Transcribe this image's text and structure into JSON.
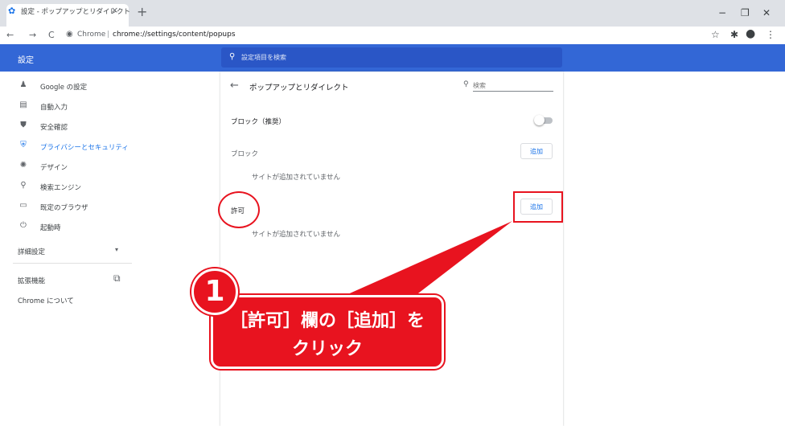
{
  "browser": {
    "tab": {
      "title": "設定 - ポップアップとリダイレクト",
      "favicon": "gear-icon",
      "close": "×"
    },
    "new_tab": "+",
    "window_controls": {
      "minimize": "−",
      "restore": "❐",
      "close": "✕"
    },
    "toolbar": {
      "back": "←",
      "forward": "→",
      "reload": "C",
      "url_host": "Chrome",
      "url_separator": "|",
      "url_path": "chrome://settings/content/popups",
      "star": "☆",
      "extensions": "✱",
      "profile": "●",
      "menu": "⋮"
    }
  },
  "settings": {
    "app_title": "設定",
    "search_placeholder": "設定項目を検索",
    "sidebar": {
      "items": [
        {
          "label": "Google の設定",
          "icon": "person-icon"
        },
        {
          "label": "自動入力",
          "icon": "clipboard-icon"
        },
        {
          "label": "安全確認",
          "icon": "shield-check-icon"
        },
        {
          "label": "プライバシーとセキュリティ",
          "icon": "shield-icon",
          "active": true
        },
        {
          "label": "デザイン",
          "icon": "palette-icon"
        },
        {
          "label": "検索エンジン",
          "icon": "search-icon"
        },
        {
          "label": "既定のブラウザ",
          "icon": "browser-icon"
        },
        {
          "label": "起動時",
          "icon": "power-icon"
        }
      ],
      "advanced_label": "詳細設定",
      "extensions_label": "拡張機能",
      "about_label": "Chrome について"
    },
    "page": {
      "title": "ポップアップとリダイレクト",
      "search_placeholder": "検索",
      "block_recommended_label": "ブロック（推奨）",
      "block_recommended_enabled": false,
      "block_section_label": "ブロック",
      "block_empty_text": "サイトが追加されていません",
      "allow_section_label": "許可",
      "allow_empty_text": "サイトが追加されていません",
      "add_button_label": "追加"
    }
  },
  "annotation": {
    "number": "1",
    "line1": "［許可］欄の［追加］を",
    "line2": "クリック",
    "accent_color": "#e8131f"
  },
  "colors": {
    "header_blue": "#3367d6",
    "accent_blue": "#1a73e8"
  }
}
